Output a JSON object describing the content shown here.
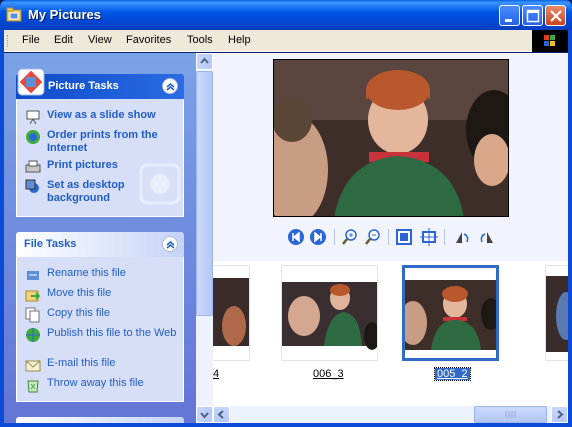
{
  "window": {
    "title": "My Pictures"
  },
  "menu": [
    "File",
    "Edit",
    "View",
    "Favorites",
    "Tools",
    "Help"
  ],
  "picture_tasks": {
    "title": "Picture Tasks",
    "items": [
      {
        "label": "View as a slide show",
        "icon": "slideshow-icon"
      },
      {
        "label": "Order prints from the Internet",
        "icon": "order-prints-icon"
      },
      {
        "label": "Print pictures",
        "icon": "printer-icon"
      },
      {
        "label": "Set as desktop background",
        "icon": "desktop-background-icon"
      }
    ]
  },
  "file_tasks": {
    "title": "File Tasks",
    "items": [
      {
        "label": "Rename this file",
        "icon": "rename-icon"
      },
      {
        "label": "Move this file",
        "icon": "move-icon"
      },
      {
        "label": "Copy this file",
        "icon": "copy-icon"
      },
      {
        "label": "Publish this file to the Web",
        "icon": "publish-web-icon"
      },
      {
        "label": "E-mail this file",
        "icon": "email-icon"
      },
      {
        "label": "Throw away this file",
        "icon": "recycle-icon"
      }
    ]
  },
  "viewer_toolbar": [
    "previous-image-icon",
    "next-image-icon",
    "zoom-in-icon",
    "zoom-out-icon",
    "best-fit-icon",
    "actual-size-icon",
    "rotate-clockwise-icon",
    "rotate-counterclockwise-icon"
  ],
  "filmstrip": [
    {
      "label": "4",
      "selected": false
    },
    {
      "label": "006_3",
      "selected": false
    },
    {
      "label": "005_2",
      "selected": true
    },
    {
      "label": "",
      "selected": false
    }
  ],
  "colors": {
    "accent": "#316AC5",
    "titlebar": "#0055E5",
    "task_link": "#215DC6",
    "pane": "#6375D6"
  }
}
